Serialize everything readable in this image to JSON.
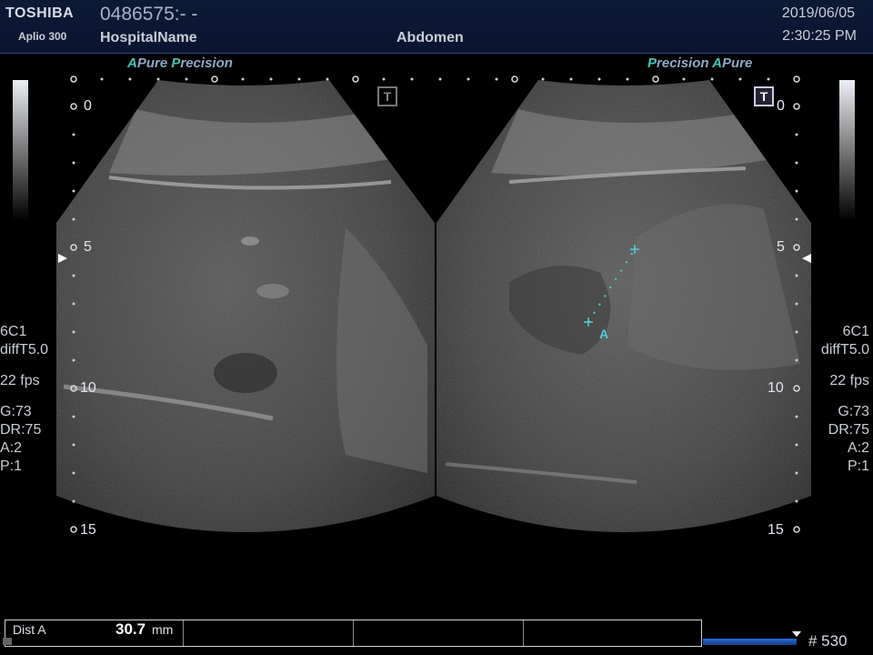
{
  "header": {
    "brand": "TOSHIBA",
    "model": "Aplio 300",
    "patient_id": "0486575:- -",
    "hospital": "HospitalName",
    "exam": "Abdomen",
    "date": "2019/06/05",
    "time": "2:30:25 PM"
  },
  "presets": {
    "left": {
      "hl": "A",
      "text": "Pure ",
      "hl2": "P",
      "text2": "recision"
    },
    "right": {
      "hl": "P",
      "text": "recision ",
      "hl2": "A",
      "text2": "Pure"
    }
  },
  "depth_marks": [
    "0",
    "5",
    "10",
    "15"
  ],
  "tbox_label": "T",
  "side_info": {
    "probe": "6C1",
    "mode": "diffT5.0",
    "fps": "22 fps",
    "gain": "G:73",
    "dr": "DR:75",
    "a": "A:2",
    "p": "P:1"
  },
  "measurement": {
    "label": "Dist A",
    "value": "30.7",
    "unit": "mm",
    "marker_label": "A"
  },
  "cine": {
    "frame": "# 530",
    "progress": 0.95
  },
  "colors": {
    "accent": "#3fc7b5",
    "header_bg": "#0d1a36",
    "cine_bar": "#2a6ad8",
    "caliper": "#4fd0e0"
  }
}
